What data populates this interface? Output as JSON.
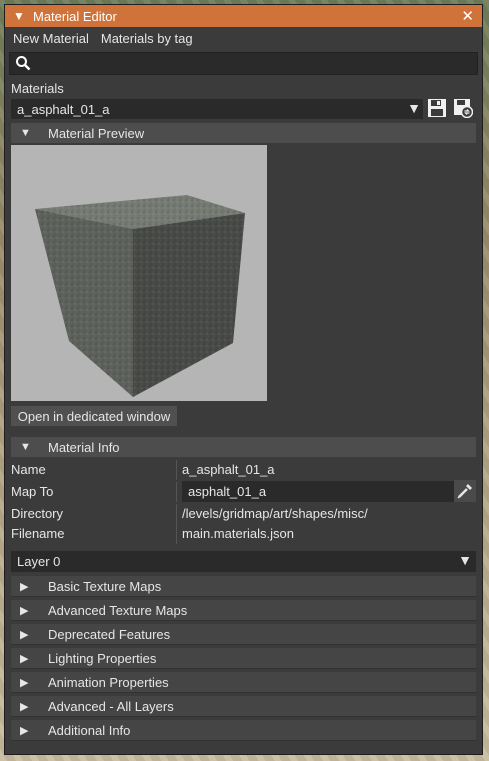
{
  "window": {
    "title": "Material Editor",
    "close_glyph": "✕"
  },
  "menu": {
    "items": [
      "New Material",
      "Materials by tag"
    ]
  },
  "search": {
    "value": ""
  },
  "materials": {
    "label": "Materials",
    "selected": "a_asphalt_01_a"
  },
  "preview": {
    "header": "Material Preview",
    "open_button": "Open in dedicated window"
  },
  "info": {
    "header": "Material Info",
    "rows": [
      {
        "key": "Name",
        "value": "a_asphalt_01_a"
      },
      {
        "key": "Map To",
        "value": "asphalt_01_a"
      },
      {
        "key": "Directory",
        "value": "/levels/gridmap/art/shapes/misc/"
      },
      {
        "key": "Filename",
        "value": "main.materials.json"
      }
    ]
  },
  "layer": {
    "selected": "Layer 0"
  },
  "sections": [
    "Basic Texture Maps",
    "Advanced Texture Maps",
    "Deprecated Features",
    "Lighting Properties",
    "Animation Properties",
    "Advanced - All Layers",
    "Additional Info"
  ],
  "colors": {
    "titlebar": "#d0733a",
    "panel": "#3b3b3b",
    "header": "#4d4d4d",
    "field": "#2a2a2a"
  }
}
